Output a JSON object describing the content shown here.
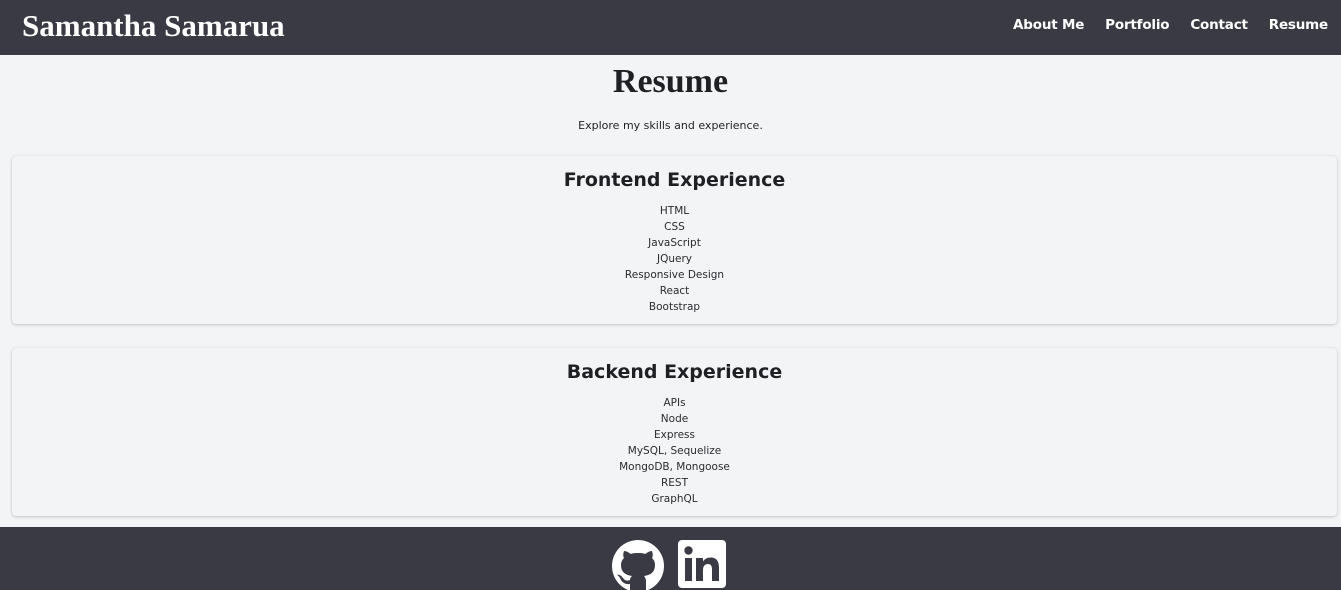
{
  "header": {
    "brand": "Samantha Samarua",
    "nav": [
      {
        "label": "About Me"
      },
      {
        "label": "Portfolio"
      },
      {
        "label": "Contact"
      },
      {
        "label": "Resume"
      }
    ]
  },
  "main": {
    "title": "Resume",
    "subtitle": "Explore my skills and experience.",
    "sections": [
      {
        "title": "Frontend Experience",
        "skills": [
          "HTML",
          "CSS",
          "JavaScript",
          "JQuery",
          "Responsive Design",
          "React",
          "Bootstrap"
        ]
      },
      {
        "title": "Backend Experience",
        "skills": [
          "APIs",
          "Node",
          "Express",
          "MySQL, Sequelize",
          "MongoDB, Mongoose",
          "REST",
          "GraphQL"
        ]
      }
    ]
  },
  "footer": {
    "icons": [
      "github-icon",
      "linkedin-icon"
    ]
  },
  "colors": {
    "header_bg": "#3a3a44",
    "page_bg": "#f3f4f6",
    "text": "#1f2023"
  }
}
